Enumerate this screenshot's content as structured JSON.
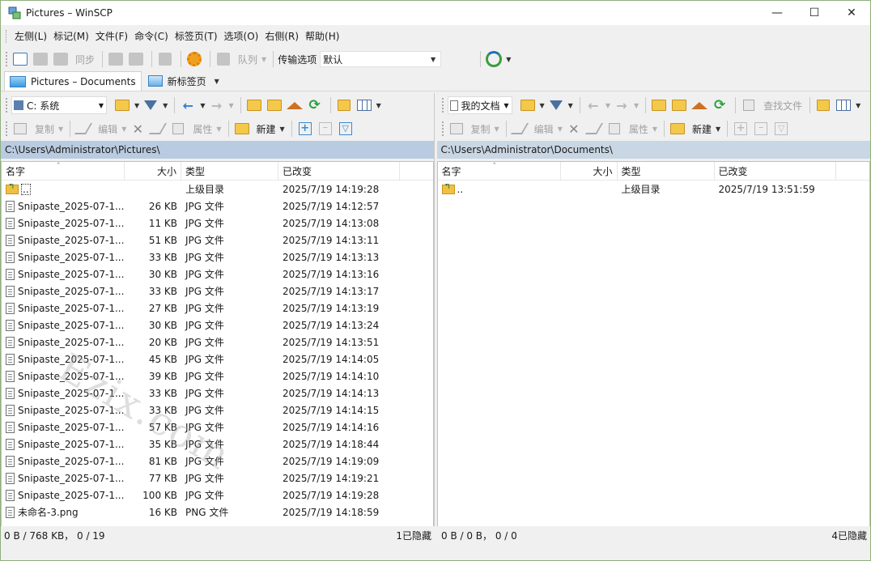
{
  "window": {
    "title": "Pictures – WinSCP"
  },
  "menu": [
    "左侧(L)",
    "标记(M)",
    "文件(F)",
    "命令(C)",
    "标签页(T)",
    "选项(O)",
    "右侧(R)",
    "帮助(H)"
  ],
  "toolbar": {
    "sync_label": "同步",
    "queue_label": "队列",
    "transfer_label": "传输选项",
    "transfer_value": "默认"
  },
  "tabs": [
    {
      "label": "Pictures – Documents",
      "active": true
    },
    {
      "label": "新标签页",
      "active": false
    }
  ],
  "left": {
    "drive": "C: 系统",
    "path": "C:\\Users\\Administrator\\Pictures\\",
    "actions": {
      "copy": "复制",
      "edit": "编辑",
      "props": "属性",
      "new": "新建"
    },
    "columns": {
      "name": "名字",
      "size": "大小",
      "type": "类型",
      "changed": "已改变"
    },
    "parent": {
      "name": "..",
      "type": "上级目录",
      "changed": "2025/7/19 14:19:28"
    },
    "rows": [
      {
        "name": "Snipaste_2025-07-1...",
        "size": "26 KB",
        "type": "JPG 文件",
        "changed": "2025/7/19 14:12:57"
      },
      {
        "name": "Snipaste_2025-07-1...",
        "size": "11 KB",
        "type": "JPG 文件",
        "changed": "2025/7/19 14:13:08"
      },
      {
        "name": "Snipaste_2025-07-1...",
        "size": "51 KB",
        "type": "JPG 文件",
        "changed": "2025/7/19 14:13:11"
      },
      {
        "name": "Snipaste_2025-07-1...",
        "size": "33 KB",
        "type": "JPG 文件",
        "changed": "2025/7/19 14:13:13"
      },
      {
        "name": "Snipaste_2025-07-1...",
        "size": "30 KB",
        "type": "JPG 文件",
        "changed": "2025/7/19 14:13:16"
      },
      {
        "name": "Snipaste_2025-07-1...",
        "size": "33 KB",
        "type": "JPG 文件",
        "changed": "2025/7/19 14:13:17"
      },
      {
        "name": "Snipaste_2025-07-1...",
        "size": "27 KB",
        "type": "JPG 文件",
        "changed": "2025/7/19 14:13:19"
      },
      {
        "name": "Snipaste_2025-07-1...",
        "size": "30 KB",
        "type": "JPG 文件",
        "changed": "2025/7/19 14:13:24"
      },
      {
        "name": "Snipaste_2025-07-1...",
        "size": "20 KB",
        "type": "JPG 文件",
        "changed": "2025/7/19 14:13:51"
      },
      {
        "name": "Snipaste_2025-07-1...",
        "size": "45 KB",
        "type": "JPG 文件",
        "changed": "2025/7/19 14:14:05"
      },
      {
        "name": "Snipaste_2025-07-1...",
        "size": "39 KB",
        "type": "JPG 文件",
        "changed": "2025/7/19 14:14:10"
      },
      {
        "name": "Snipaste_2025-07-1...",
        "size": "33 KB",
        "type": "JPG 文件",
        "changed": "2025/7/19 14:14:13"
      },
      {
        "name": "Snipaste_2025-07-1...",
        "size": "33 KB",
        "type": "JPG 文件",
        "changed": "2025/7/19 14:14:15"
      },
      {
        "name": "Snipaste_2025-07-1...",
        "size": "57 KB",
        "type": "JPG 文件",
        "changed": "2025/7/19 14:14:16"
      },
      {
        "name": "Snipaste_2025-07-1...",
        "size": "35 KB",
        "type": "JPG 文件",
        "changed": "2025/7/19 14:18:44"
      },
      {
        "name": "Snipaste_2025-07-1...",
        "size": "81 KB",
        "type": "JPG 文件",
        "changed": "2025/7/19 14:19:09"
      },
      {
        "name": "Snipaste_2025-07-1...",
        "size": "77 KB",
        "type": "JPG 文件",
        "changed": "2025/7/19 14:19:21"
      },
      {
        "name": "Snipaste_2025-07-1...",
        "size": "100 KB",
        "type": "JPG 文件",
        "changed": "2025/7/19 14:19:28"
      },
      {
        "name": "未命名-3.png",
        "size": "16 KB",
        "type": "PNG 文件",
        "changed": "2025/7/19 14:18:59"
      }
    ],
    "status_left": "0 B / 768 KB， 0 / 19",
    "status_right": "1已隐藏"
  },
  "right": {
    "drive": "我的文档",
    "path": "C:\\Users\\Administrator\\Documents\\",
    "find_label": "查找文件",
    "actions": {
      "copy": "复制",
      "edit": "编辑",
      "props": "属性",
      "new": "新建"
    },
    "columns": {
      "name": "名字",
      "size": "大小",
      "type": "类型",
      "changed": "已改变"
    },
    "parent": {
      "name": "..",
      "type": "上级目录",
      "changed": "2025/7/19 13:51:59"
    },
    "status_left": "0 B / 0 B， 0 / 0",
    "status_right": "4已隐藏"
  },
  "watermark": "Ezix.com"
}
